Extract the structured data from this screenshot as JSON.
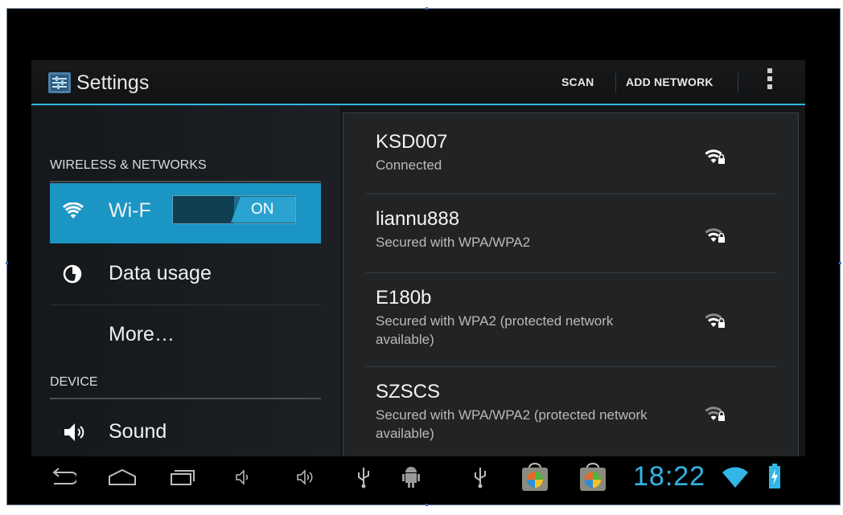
{
  "colors": {
    "accent": "#33b5e5",
    "selected_row": "#1b95c4",
    "background": "#000000"
  },
  "action_bar": {
    "title": "Settings",
    "app_icon": "settings-app-icon",
    "scan_label": "SCAN",
    "add_network_label": "ADD NETWORK",
    "overflow_icon": "overflow-menu-icon"
  },
  "sidebar": {
    "sections": [
      {
        "header": "WIRELESS & NETWORKS"
      },
      {
        "header": "DEVICE"
      }
    ],
    "items": [
      {
        "label": "Wi-Fi",
        "visible_label": "Wi-F",
        "icon": "wifi-icon",
        "selected": true,
        "toggle": "ON"
      },
      {
        "label": "Data usage",
        "icon": "data-usage-icon"
      },
      {
        "label": "More…",
        "icon": ""
      },
      {
        "label": "Sound",
        "icon": "speaker-icon"
      }
    ]
  },
  "networks": [
    {
      "ssid": "KSD007",
      "status": "Connected",
      "icon": "wifi-locked-icon"
    },
    {
      "ssid": "liannu888",
      "status": "Secured with WPA/WPA2",
      "icon": "wifi-locked-icon"
    },
    {
      "ssid": "E180b",
      "status": "Secured with WPA2 (protected network available)",
      "icon": "wifi-locked-icon"
    },
    {
      "ssid": "SZSCS",
      "status": "Secured with WPA/WPA2 (protected network available)",
      "icon": "wifi-locked-icon"
    }
  ],
  "navbar": {
    "buttons": [
      "back-icon",
      "home-icon",
      "recent-apps-icon",
      "volume-down-icon",
      "volume-up-icon"
    ],
    "notifications": [
      "usb-icon",
      "android-debug-icon",
      "usb-icon",
      "market-app-icon",
      "market-app-icon"
    ],
    "clock": "18:22",
    "status_icons": [
      "wifi-signal-icon",
      "battery-charging-icon"
    ]
  }
}
